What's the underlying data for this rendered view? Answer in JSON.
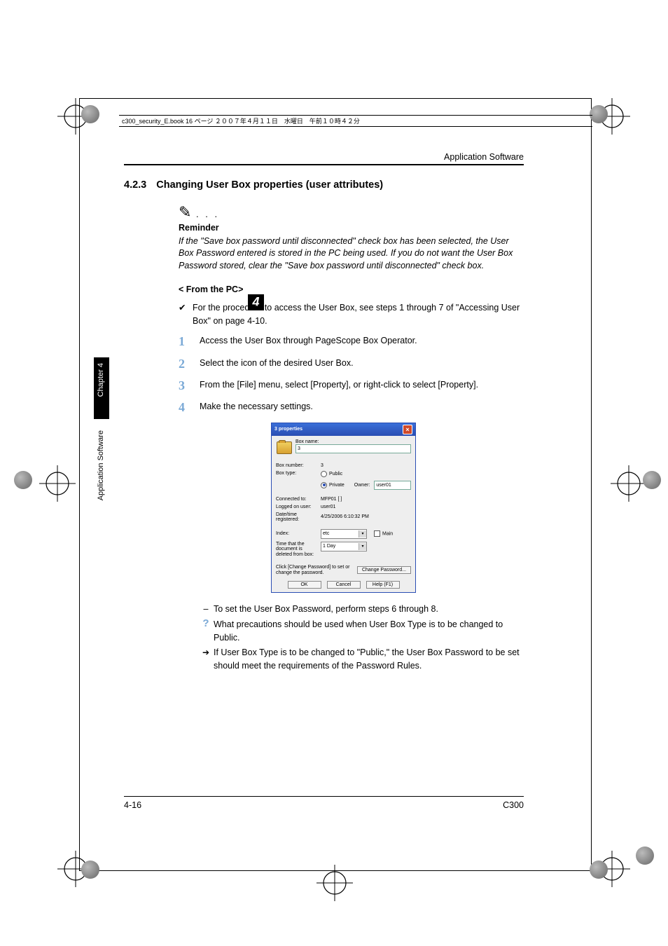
{
  "header_strip": "c300_security_E.book  16 ページ  ２００７年４月１１日　水曜日　午前１０時４２分",
  "chapter_badge": "4",
  "header_right": "Application Software",
  "section": {
    "number": "4.2.3",
    "title": "Changing User Box properties (user attributes)"
  },
  "reminder": {
    "heading": "Reminder",
    "text": "If the \"Save box password until disconnected\" check box has been selected, the User Box Password entered is stored in the PC being used. If you do not want the User Box Password stored, clear the \"Save box password until disconnected\" check box."
  },
  "from_pc": "< From the PC>",
  "intro_bullet": "For the procedure to access the User Box, see steps 1 through 7 of \"Accessing User Box\" on page 4-10.",
  "steps": [
    "Access the User Box through PageScope Box Operator.",
    "Select the icon of the desired User Box.",
    "From the [File] menu, select [Property], or right-click to select [Property].",
    "Make the necessary settings."
  ],
  "dialog": {
    "title": "3 properties",
    "box_name_label": "Box name:",
    "box_name_value": "3",
    "box_number_label": "Box number:",
    "box_number_value": "3",
    "box_type_label": "Box type:",
    "box_type_public": "Public",
    "box_type_private": "Private",
    "owner_label": "Owner:",
    "owner_value": "user01",
    "connected_label": "Connected to:",
    "connected_value": "MFP01 [                    ]",
    "logged_label": "Logged on user:",
    "logged_value": "user01",
    "datetime_label": "Date/time registered:",
    "datetime_value": "4/25/2006 6:10:32 PM",
    "index_label": "Index:",
    "index_value": "etc",
    "main_label": "Main",
    "time_delete_label": "Time that the document is deleted from box:",
    "time_delete_value": "1 Day",
    "change_pw_hint": "Click [Change Password] to set or change the password.",
    "change_pw_btn": "Change Password...",
    "ok": "OK",
    "cancel": "Cancel",
    "help": "Help (F1)"
  },
  "sub_items": {
    "dash": "To set the User Box Password, perform steps 6 through 8.",
    "q": "What precautions should be used when User Box Type is to be changed to Public.",
    "arrow": "If User Box Type is to be changed to \"Public,\" the User Box Password to be set should meet the requirements of the Password Rules."
  },
  "side_tabs": {
    "chapter": "Chapter 4",
    "section": "Application Software"
  },
  "footer_left": "4-16",
  "footer_right": "C300"
}
